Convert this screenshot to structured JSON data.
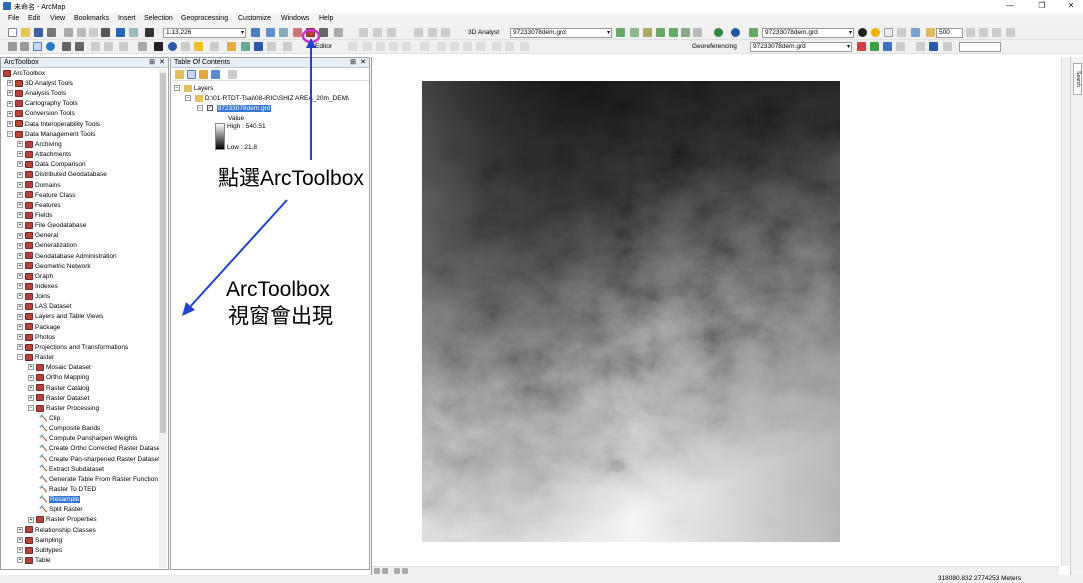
{
  "window": {
    "title": "未命名 - ArcMap",
    "controls": [
      "—",
      "❐",
      "✕"
    ]
  },
  "menu": [
    "File",
    "Edit",
    "View",
    "Bookmarks",
    "Insert",
    "Selection",
    "Geoprocessing",
    "Customize",
    "Windows",
    "Help"
  ],
  "toolbar": {
    "scale": "1:13,226",
    "analyst_label": "3D Analyst",
    "analyst_layer": "97233078dem.grd",
    "layer_combo_2": "97233078dem.grd",
    "zoom_value": "500",
    "editor_label": "Editor",
    "georef_label": "Georeferencing",
    "georef_layer": "97233078dem.grd"
  },
  "toolbox": {
    "title": "ArcToolbox",
    "root": "ArcToolbox",
    "items": [
      {
        "label": "3D Analyst Tools",
        "level": 0,
        "kind": "toolbox",
        "exp": "+"
      },
      {
        "label": "Analysis Tools",
        "level": 0,
        "kind": "toolbox",
        "exp": "+"
      },
      {
        "label": "Cartography Tools",
        "level": 0,
        "kind": "toolbox",
        "exp": "+"
      },
      {
        "label": "Conversion Tools",
        "level": 0,
        "kind": "toolbox",
        "exp": "+"
      },
      {
        "label": "Data Interoperability Tools",
        "level": 0,
        "kind": "toolbox",
        "exp": "+"
      },
      {
        "label": "Data Management Tools",
        "level": 0,
        "kind": "toolbox",
        "exp": "−"
      },
      {
        "label": "Archiving",
        "level": 1,
        "kind": "toolbox",
        "exp": "+"
      },
      {
        "label": "Attachments",
        "level": 1,
        "kind": "toolbox",
        "exp": "+"
      },
      {
        "label": "Data Comparison",
        "level": 1,
        "kind": "toolbox",
        "exp": "+"
      },
      {
        "label": "Distributed Geodatabase",
        "level": 1,
        "kind": "toolbox",
        "exp": "+"
      },
      {
        "label": "Domains",
        "level": 1,
        "kind": "toolbox",
        "exp": "+"
      },
      {
        "label": "Feature Class",
        "level": 1,
        "kind": "toolbox",
        "exp": "+"
      },
      {
        "label": "Features",
        "level": 1,
        "kind": "toolbox",
        "exp": "+"
      },
      {
        "label": "Fields",
        "level": 1,
        "kind": "toolbox",
        "exp": "+"
      },
      {
        "label": "File Geodatabase",
        "level": 1,
        "kind": "toolbox",
        "exp": "+"
      },
      {
        "label": "General",
        "level": 1,
        "kind": "toolbox",
        "exp": "+"
      },
      {
        "label": "Generalization",
        "level": 1,
        "kind": "toolbox",
        "exp": "+"
      },
      {
        "label": "Geodatabase Administration",
        "level": 1,
        "kind": "toolbox",
        "exp": "+"
      },
      {
        "label": "Geometric Network",
        "level": 1,
        "kind": "toolbox",
        "exp": "+"
      },
      {
        "label": "Graph",
        "level": 1,
        "kind": "toolbox",
        "exp": "+"
      },
      {
        "label": "Indexes",
        "level": 1,
        "kind": "toolbox",
        "exp": "+"
      },
      {
        "label": "Joins",
        "level": 1,
        "kind": "toolbox",
        "exp": "+"
      },
      {
        "label": "LAS Dataset",
        "level": 1,
        "kind": "toolbox",
        "exp": "+"
      },
      {
        "label": "Layers and Table Views",
        "level": 1,
        "kind": "toolbox",
        "exp": "+"
      },
      {
        "label": "Package",
        "level": 1,
        "kind": "toolbox",
        "exp": "+"
      },
      {
        "label": "Photos",
        "level": 1,
        "kind": "toolbox",
        "exp": "+"
      },
      {
        "label": "Projections and Transformations",
        "level": 1,
        "kind": "toolbox",
        "exp": "+"
      },
      {
        "label": "Raster",
        "level": 1,
        "kind": "toolbox",
        "exp": "−"
      },
      {
        "label": "Mosaic Dataset",
        "level": 2,
        "kind": "toolbox",
        "exp": "+"
      },
      {
        "label": "Ortho Mapping",
        "level": 2,
        "kind": "toolbox",
        "exp": "+"
      },
      {
        "label": "Raster Catalog",
        "level": 2,
        "kind": "toolbox",
        "exp": "+"
      },
      {
        "label": "Raster Dataset",
        "level": 2,
        "kind": "toolbox",
        "exp": "+"
      },
      {
        "label": "Raster Processing",
        "level": 2,
        "kind": "toolbox",
        "exp": "−"
      },
      {
        "label": "Clip",
        "level": 3,
        "kind": "tool",
        "exp": ""
      },
      {
        "label": "Composite Bands",
        "level": 3,
        "kind": "tool",
        "exp": ""
      },
      {
        "label": "Compute Pansharpen Weights",
        "level": 3,
        "kind": "tool",
        "exp": ""
      },
      {
        "label": "Create Ortho Corrected Raster Dataset",
        "level": 3,
        "kind": "tool",
        "exp": ""
      },
      {
        "label": "Create Pan-sharpened Raster Dataset",
        "level": 3,
        "kind": "tool",
        "exp": ""
      },
      {
        "label": "Extract Subdataset",
        "level": 3,
        "kind": "tool",
        "exp": ""
      },
      {
        "label": "Generate Table From Raster Function",
        "level": 3,
        "kind": "tool",
        "exp": ""
      },
      {
        "label": "Raster To DTED",
        "level": 3,
        "kind": "tool",
        "exp": ""
      },
      {
        "label": "Resample",
        "level": 3,
        "kind": "tool",
        "exp": "",
        "selected": true
      },
      {
        "label": "Split Raster",
        "level": 3,
        "kind": "tool",
        "exp": ""
      },
      {
        "label": "Raster Properties",
        "level": 2,
        "kind": "toolbox",
        "exp": "+"
      },
      {
        "label": "Relationship Classes",
        "level": 1,
        "kind": "toolbox",
        "exp": "+"
      },
      {
        "label": "Sampling",
        "level": 1,
        "kind": "toolbox",
        "exp": "+"
      },
      {
        "label": "Subtypes",
        "level": 1,
        "kind": "toolbox",
        "exp": "+"
      },
      {
        "label": "Table",
        "level": 1,
        "kind": "toolbox",
        "exp": "+"
      }
    ]
  },
  "toc": {
    "title": "Table Of Contents",
    "layers_label": "Layers",
    "folder_path": "D:\\01-RTDT-Tsai\\08-iRIC\\SHIZ AREA_20m_DEM\\",
    "layer_name": "97233078dem.grd",
    "legend_value_label": "Value",
    "legend_high": "High : 540.51",
    "legend_low": "Low : 21.8"
  },
  "status": {
    "coordinates": "318080.832  2774253 Meters"
  },
  "annotations": {
    "click_note": "點選ArcToolbox",
    "window_note_line1": "ArcToolbox",
    "window_note_line2": "視窗會出現",
    "arrow_color": "#2244cc",
    "highlight_color": "#cc33cc"
  },
  "right_strip": {
    "search_tab": "Search"
  }
}
